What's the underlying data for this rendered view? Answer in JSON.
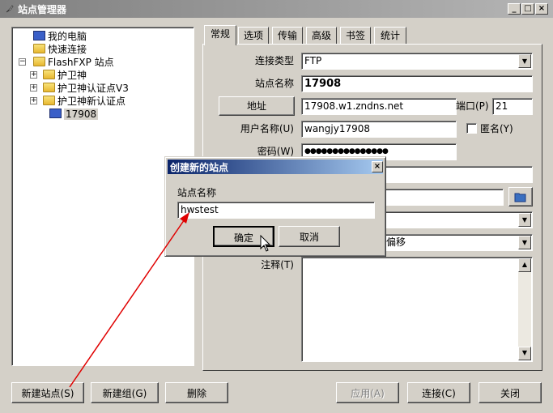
{
  "window": {
    "title": "站点管理器",
    "min": "_",
    "max": "□",
    "close": "×"
  },
  "tree": {
    "items": [
      {
        "label": "我的电脑",
        "icon": "computer-icon",
        "level": 1
      },
      {
        "label": "快速连接",
        "icon": "folder-icon",
        "level": 1
      },
      {
        "label": "FlashFXP 站点",
        "icon": "folder-icon",
        "level": 1,
        "expander": "−"
      },
      {
        "label": "护卫神",
        "icon": "folder-icon",
        "level": 2,
        "expander": "+"
      },
      {
        "label": "护卫神认证点V3",
        "icon": "folder-icon",
        "level": 2,
        "expander": "+"
      },
      {
        "label": "护卫神新认证点",
        "icon": "folder-icon",
        "level": 2,
        "expander": "+"
      },
      {
        "label": "17908",
        "icon": "computer-icon",
        "level": 2,
        "selected": true
      }
    ]
  },
  "tabs": [
    "常规",
    "选项",
    "传输",
    "高级",
    "书签",
    "统计"
  ],
  "form": {
    "conn_type_label": "连接类型",
    "conn_type_value": "FTP",
    "site_name_label": "站点名称",
    "site_name_value": "17908",
    "address_button": "地址",
    "address_value": "17908.w1.zndns.net",
    "port_label": "端口(P)",
    "port_value": "21",
    "username_label": "用户名称(U)",
    "username_value": "wangjy17908",
    "anon_label": "匿名(Y)",
    "password_label": "密码(W)",
    "password_value": "●●●●●●●●●●●●●●●",
    "partial_text": "偏移",
    "notes_label": "注释(T)"
  },
  "buttons": {
    "new_site": "新建站点(S)",
    "new_group": "新建组(G)",
    "delete": "删除",
    "apply": "应用(A)",
    "connect": "连接(C)",
    "close": "关闭"
  },
  "dialog": {
    "title": "创建新的站点",
    "close": "×",
    "field_label": "站点名称",
    "field_value": "hwstest",
    "ok": "确定",
    "cancel": "取消"
  },
  "colors": {
    "annotation_arrow": "#e00000",
    "dialog_title": "#0a246a"
  }
}
